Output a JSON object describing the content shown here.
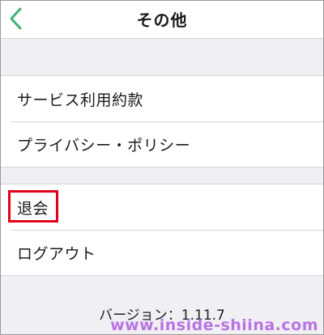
{
  "header": {
    "title": "その他",
    "back_icon": "chevron-left-icon",
    "accent_color": "#3cb371"
  },
  "menu": {
    "group1": [
      {
        "label": "サービス利用約款"
      },
      {
        "label": "プライバシー・ポリシー"
      }
    ],
    "group2": [
      {
        "label": "退会"
      },
      {
        "label": "ログアウト"
      }
    ],
    "highlight_color": "#e3001b"
  },
  "footer": {
    "version_text": "バージョン：1.11.7"
  },
  "watermark": {
    "text": "www.inside-shiina.com"
  }
}
